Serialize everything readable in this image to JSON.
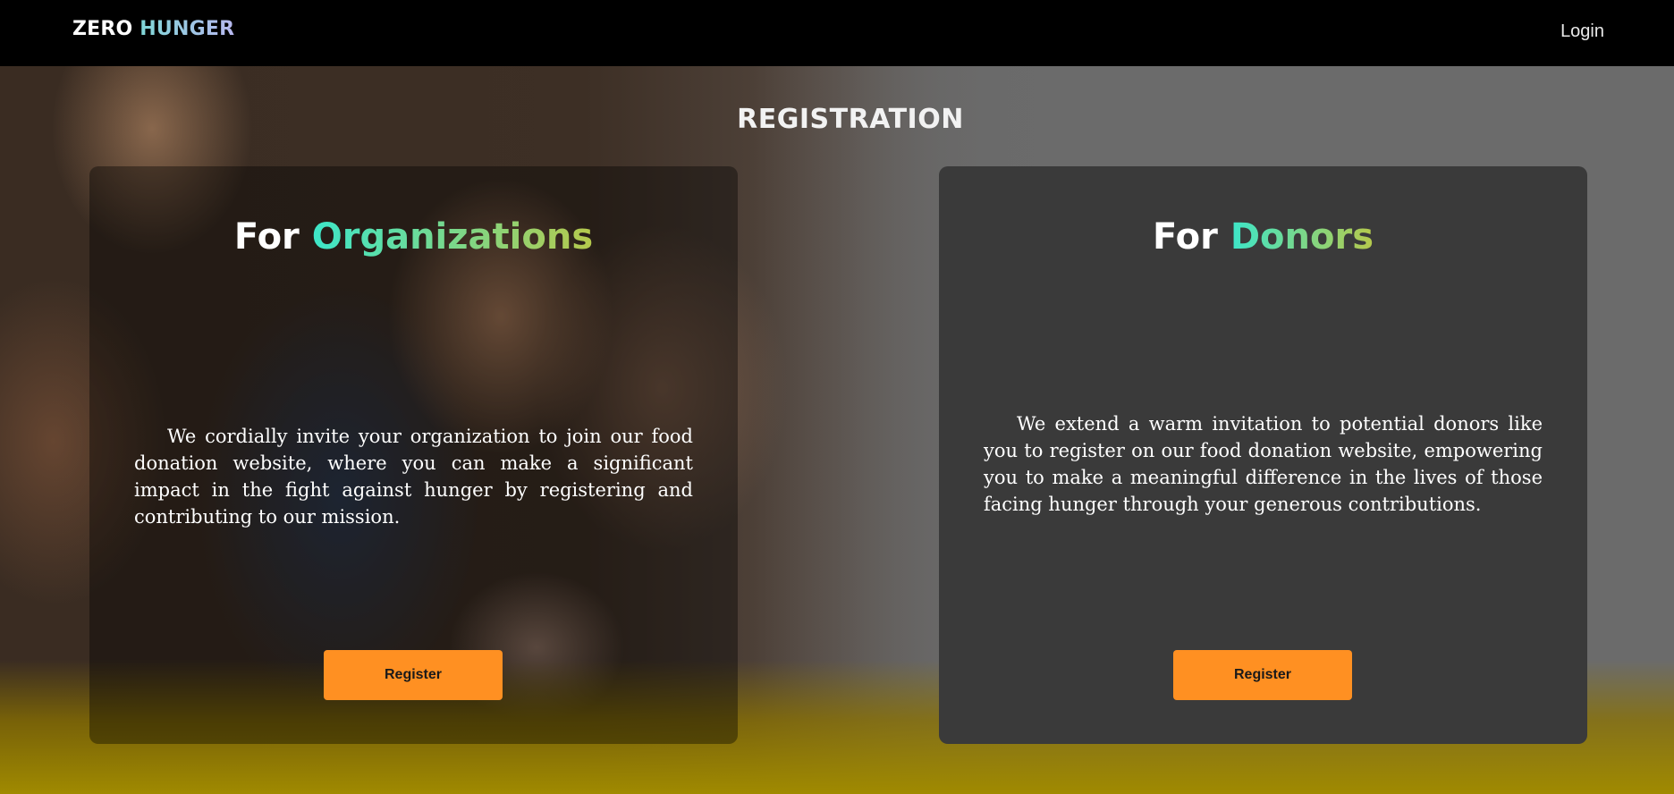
{
  "nav": {
    "brand_word1": "ZERO",
    "brand_word2": "HUNGER",
    "login_label": "Login"
  },
  "page": {
    "heading": "REGISTRATION"
  },
  "cards": [
    {
      "title_prefix": "For",
      "title_highlight": "Organizations",
      "body": "We cordially invite your organization to join our food donation website, where you can make a significant impact in the fight against hunger by registering and contributing to our mission.",
      "button_label": "Register"
    },
    {
      "title_prefix": "For",
      "title_highlight": "Donors",
      "body": "We extend a warm invitation to potential donors like you to register on our food donation website, empowering you to make a meaningful difference in the lives of those facing hunger through your generous contributions.",
      "button_label": "Register"
    }
  ],
  "colors": {
    "nav_background": "#000000",
    "accent_button": "#ff9022",
    "highlight_gradient_start": "#3de6c9",
    "highlight_gradient_end": "#b6c94c"
  }
}
